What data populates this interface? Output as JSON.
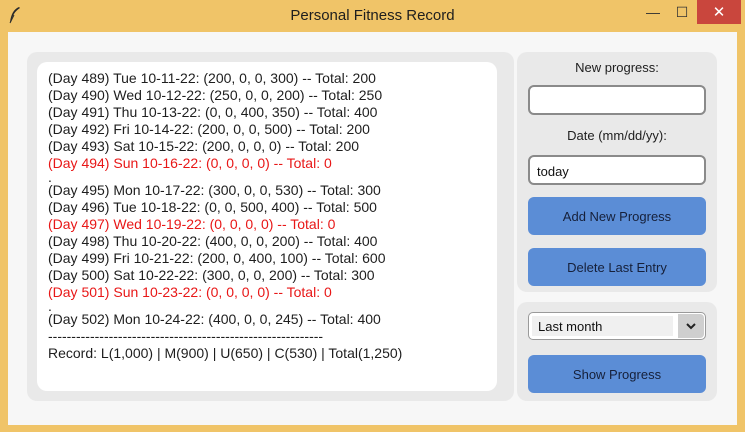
{
  "window": {
    "title": "Personal Fitness Record",
    "minimize_glyph": "—",
    "maximize_glyph": "☐",
    "close_glyph": "✕",
    "icon": "feather-icon"
  },
  "log": {
    "lines": [
      {
        "text": "(Day 489) Tue 10-11-22: (200, 0, 0, 300) -- Total: 200",
        "style": "normal"
      },
      {
        "text": "(Day 490) Wed 10-12-22: (250, 0, 0, 200) -- Total: 250",
        "style": "normal"
      },
      {
        "text": "(Day 491) Thu 10-13-22: (0, 0, 400, 350) -- Total: 400",
        "style": "normal"
      },
      {
        "text": "(Day 492) Fri 10-14-22: (200, 0, 0, 500) -- Total: 200",
        "style": "normal"
      },
      {
        "text": "(Day 493) Sat 10-15-22: (200, 0, 0, 0) -- Total: 200",
        "style": "normal"
      },
      {
        "text": "(Day 494) Sun 10-16-22: (0, 0, 0, 0) -- Total: 0",
        "style": "red"
      },
      {
        "text": ".",
        "style": "dot"
      },
      {
        "text": "(Day 495) Mon 10-17-22: (300, 0, 0, 530) -- Total: 300",
        "style": "normal"
      },
      {
        "text": "(Day 496) Tue 10-18-22: (0, 0, 500, 400) -- Total: 500",
        "style": "normal"
      },
      {
        "text": "(Day 497) Wed 10-19-22: (0, 0, 0, 0) -- Total: 0",
        "style": "red"
      },
      {
        "text": "(Day 498) Thu 10-20-22: (400, 0, 0, 200) -- Total: 400",
        "style": "normal"
      },
      {
        "text": "(Day 499) Fri 10-21-22: (200, 0, 400, 100) -- Total: 600",
        "style": "normal"
      },
      {
        "text": "(Day 500) Sat 10-22-22: (300, 0, 0, 200) -- Total: 300",
        "style": "normal"
      },
      {
        "text": "(Day 501) Sun 10-23-22: (0, 0, 0, 0) -- Total: 0",
        "style": "red"
      },
      {
        "text": ".",
        "style": "dot"
      },
      {
        "text": "(Day 502) Mon 10-24-22: (400, 0, 0, 245) -- Total: 400",
        "style": "normal"
      },
      {
        "text": "-----------------------------------------------------------",
        "style": "normal"
      },
      {
        "text": "Record: L(1,000) | M(900) | U(650) | C(530) | Total(1,250)",
        "style": "normal"
      }
    ]
  },
  "form": {
    "progress_label": "New progress:",
    "progress_value": "",
    "date_label": "Date (mm/dd/yy):",
    "date_value": "today",
    "add_button": "Add New Progress",
    "delete_button": "Delete Last Entry"
  },
  "view": {
    "range_selected": "Last month",
    "dropdown_icon": "chevron-down-icon",
    "show_button": "Show Progress"
  },
  "colors": {
    "titlebar": "#f0c468",
    "button": "#5b8dd6",
    "zero_entry": "#e81717",
    "close": "#c9463d"
  }
}
